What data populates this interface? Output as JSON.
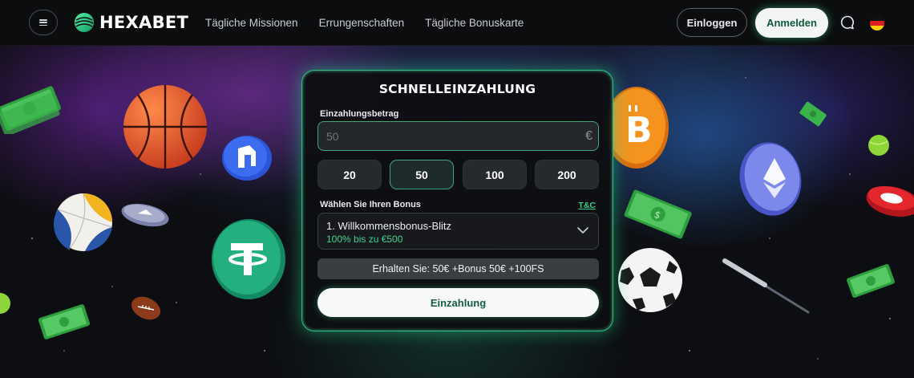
{
  "header": {
    "brand": "HEXABET",
    "nav": [
      "Tägliche Missionen",
      "Errungenschaften",
      "Tägliche Bonuskarte"
    ],
    "login_label": "Einloggen",
    "register_label": "Anmelden",
    "icons": {
      "menu": "hamburger-menu-icon",
      "chat": "chat-bubble-icon",
      "language": "german-flag-icon"
    }
  },
  "deposit": {
    "title": "SCHNELLEINZAHLUNG",
    "amount_label": "Einzahlungsbetrag",
    "amount_placeholder": "50",
    "currency_symbol": "€",
    "presets": [
      "20",
      "50",
      "100",
      "200"
    ],
    "selected_preset": "50",
    "bonus_label": "Wählen Sie Ihren Bonus",
    "tc_label": "T&C",
    "bonus": {
      "name": "1. Willkommensbonus-Blitz",
      "detail": "100% bis zu €500"
    },
    "summary": "Erhalten Sie: 50€ +Bonus 50€ +100FS",
    "submit_label": "Einzahlung"
  },
  "colors": {
    "accent_green": "#35d08a",
    "card_border": "#2fbf84",
    "button_text": "#145c40",
    "background": "#0c0d0f"
  }
}
